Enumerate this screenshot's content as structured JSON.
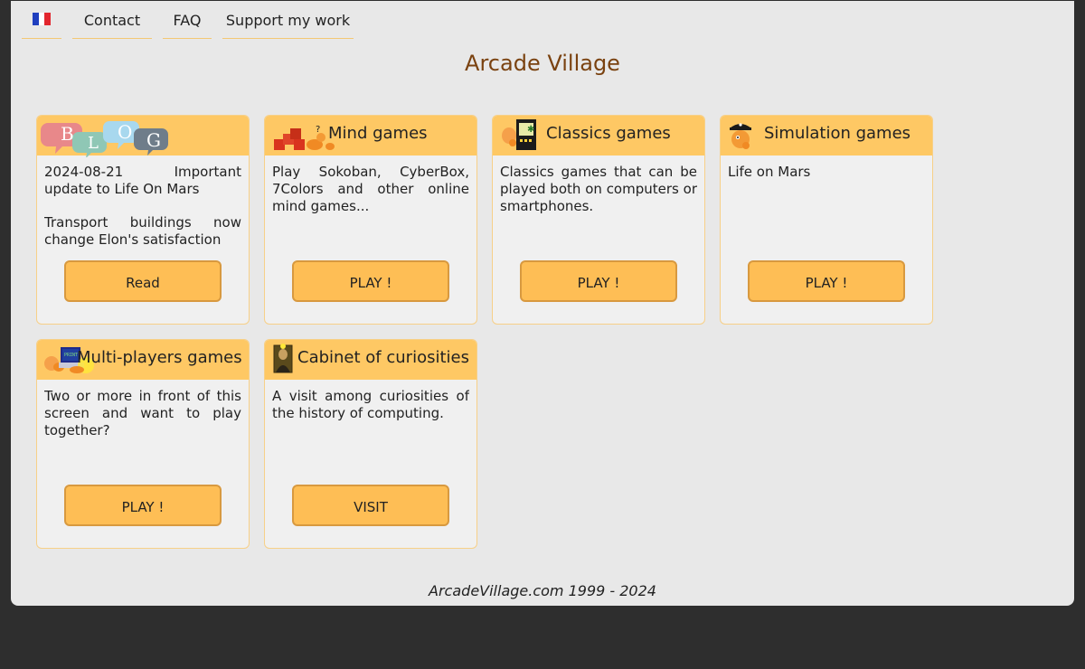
{
  "nav": {
    "flag_label": "fr",
    "items": [
      {
        "label": "Contact"
      },
      {
        "label": "FAQ"
      },
      {
        "label": "Support my work"
      }
    ]
  },
  "site_title": "Arcade Village",
  "colors": {
    "background": "#e8e8e8",
    "outer": "#2e2e2e",
    "card_header": "#fec864",
    "button": "#febe55",
    "title": "#7a4210"
  },
  "blog": {
    "icon_letters": [
      "B",
      "L",
      "O",
      "G"
    ],
    "post": "2024-08-21 Important update to Life On Mars",
    "excerpt": "Transport buildings now change Elon's satisfaction",
    "button": "Read"
  },
  "cards": [
    {
      "title": "Mind games",
      "icon": "puzzle-blocks-icon",
      "text": "Play Sokoban, CyberBox, 7Colors and other online mind games...",
      "button": "PLAY !"
    },
    {
      "title": "Classics games",
      "icon": "arcade-cabinet-icon",
      "text": "Classics games that can be played both on computers or smartphones.",
      "button": "PLAY !"
    },
    {
      "title": "Simulation games",
      "icon": "pirate-mascot-icon",
      "text": "Life on Mars",
      "button": "PLAY !"
    },
    {
      "title": "Multi-players games",
      "icon": "multiplayer-computer-icon",
      "text": "Two or more in front of this screen and want to play together?",
      "button": "PLAY !"
    },
    {
      "title": "Cabinet of curiosities",
      "icon": "mona-lisa-icon",
      "text": "A visit among curiosities of the history of computing.",
      "button": "VISIT"
    }
  ],
  "footer": "ArcadeVillage.com 1999 - 2024"
}
